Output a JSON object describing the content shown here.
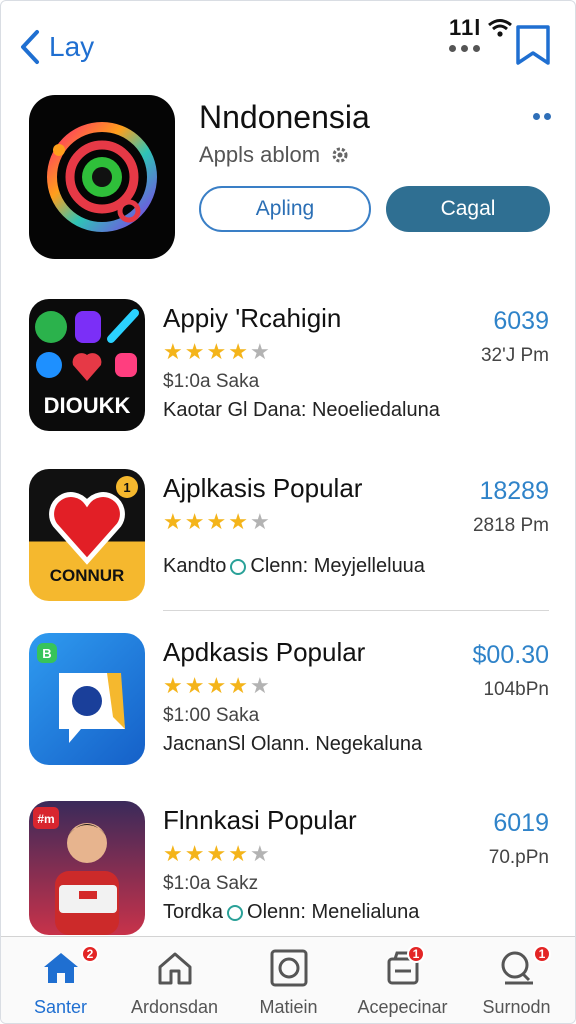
{
  "nav": {
    "back_label": "Lay"
  },
  "status": {
    "signal_text": "11l"
  },
  "header": {
    "title": "Nndonensia",
    "subtitle": "Appls ablom",
    "button_outline_label": "Apling",
    "button_solid_label": "Cagal"
  },
  "apps": [
    {
      "name": "Appiy 'Rcahigin",
      "rating": 4,
      "size": "$1:0a Saka",
      "developer_prefix": "Kaotar Gl Dana: Neoeliedaluna",
      "developer_suffix": "",
      "show_dev_icon": false,
      "price": "6039",
      "time": "32'J Pm",
      "icon_text": "DIOUKK"
    },
    {
      "name": "Ajplkasis Popular",
      "rating": 4,
      "size": "",
      "developer_prefix": "Kandto",
      "developer_suffix": "Clenn: Meyjelleluua",
      "show_dev_icon": true,
      "price": "18289",
      "time": "2818 Pm",
      "icon_text": "CONNUR"
    },
    {
      "name": "Apdkasis Popular",
      "rating": 4,
      "size": "$1:00 Saka",
      "developer_prefix": "JacnanSl Olann. Negekaluna",
      "developer_suffix": "",
      "show_dev_icon": false,
      "price": "$00.30",
      "time": "104bPn",
      "icon_text": "B"
    },
    {
      "name": "Flnnkasi Popular",
      "rating": 4,
      "size": "$1:0a Sakz",
      "developer_prefix": "Tordka",
      "developer_suffix": "Olenn: Menelialuna",
      "show_dev_icon": true,
      "price": "6019",
      "time": "70.pPn",
      "icon_text": "#m"
    }
  ],
  "tabs": [
    {
      "label": "Santer",
      "icon": "home-filled-icon",
      "badge": "2",
      "active": true
    },
    {
      "label": "Ardonsdan",
      "icon": "home-outline-icon",
      "badge": "",
      "active": false
    },
    {
      "label": "Matiein",
      "icon": "square-box-icon",
      "badge": "",
      "active": false
    },
    {
      "label": "Acepecinar",
      "icon": "updates-icon",
      "badge": "1",
      "active": false
    },
    {
      "label": "Surnodn",
      "icon": "search-icon",
      "badge": "1",
      "active": false
    }
  ],
  "colors": {
    "accent": "#1f6fd1",
    "price": "#2f83c9",
    "solid_button": "#2f6f92",
    "star": "#f4b41a",
    "badge": "#e32525"
  }
}
